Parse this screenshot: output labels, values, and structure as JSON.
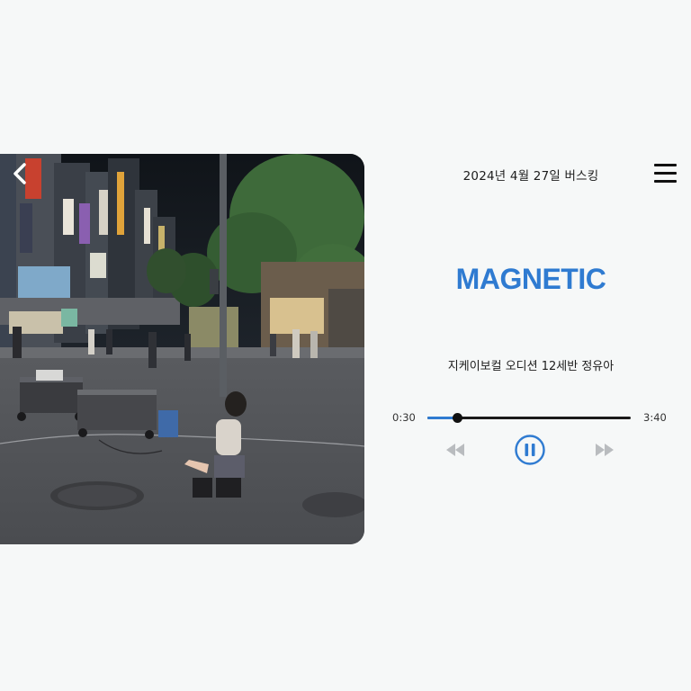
{
  "header": {
    "date_title": "2024년 4월 27일 버스킹"
  },
  "track": {
    "title": "MAGNETIC",
    "performer": "지케이보컬 오디션 12세반 정유아",
    "current_time": "0:30",
    "total_time": "3:40",
    "progress_fraction": 0.15
  },
  "icons": {
    "back": "chevron-left-icon",
    "menu": "hamburger-menu-icon",
    "rewind": "rewind-icon",
    "pause": "pause-icon",
    "forward": "fast-forward-icon"
  },
  "colors": {
    "accent": "#2f7bd1",
    "inactive_control": "#b9bcbf",
    "background": "#f6f8f8"
  }
}
